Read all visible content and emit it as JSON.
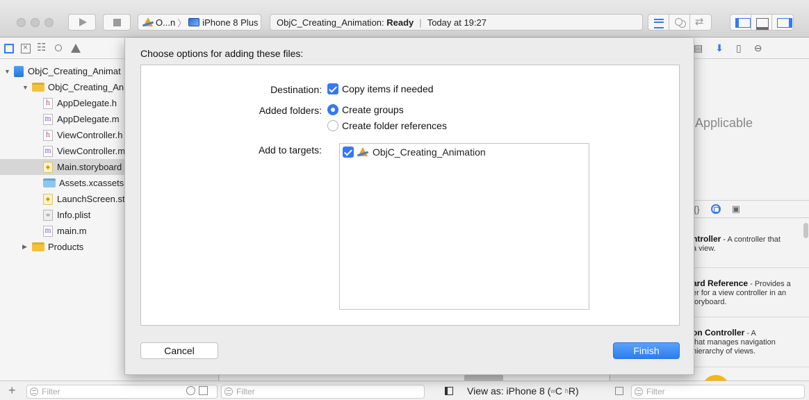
{
  "toolbar": {
    "scheme_name": "O...n",
    "device": "iPhone 8 Plus",
    "status_project": "ObjC_Creating_Animation:",
    "status_state": "Ready",
    "status_time": "Today at 19:27"
  },
  "navigator": {
    "items": [
      {
        "label": "ObjC_Creating_Animat",
        "kind": "project"
      },
      {
        "label": "ObjC_Creating_Anir",
        "kind": "folder"
      },
      {
        "label": "AppDelegate.h",
        "kind": "h"
      },
      {
        "label": "AppDelegate.m",
        "kind": "m"
      },
      {
        "label": "ViewController.h",
        "kind": "h"
      },
      {
        "label": "ViewController.m",
        "kind": "m"
      },
      {
        "label": "Main.storyboard",
        "kind": "storyboard"
      },
      {
        "label": "Assets.xcassets",
        "kind": "assets"
      },
      {
        "label": "LaunchScreen.st",
        "kind": "storyboard"
      },
      {
        "label": "Info.plist",
        "kind": "plist"
      },
      {
        "label": "main.m",
        "kind": "m"
      },
      {
        "label": "Products",
        "kind": "folder"
      }
    ],
    "file_letters": {
      "h": "h",
      "m": "m"
    },
    "filter_placeholder": "Filter"
  },
  "inspector": {
    "not_applicable": "Applicable",
    "library_items": [
      {
        "title": "ntroller",
        "desc_1": " - A controller that",
        "desc_2": "a view."
      },
      {
        "title": "ard Reference",
        "desc_1": " - Provides a",
        "desc_2": "er for a view controller in an",
        "desc_3": "toryboard."
      },
      {
        "title": "on Controller",
        "desc_1": " - A",
        "desc_2": "that manages navigation",
        "desc_3": "hierarchy of views."
      }
    ],
    "filter_placeholder": "Filter"
  },
  "editor": {
    "filter_placeholder": "Filter",
    "view_as_prefix": "View as: iPhone 8 (",
    "size_w": "w",
    "size_c": "C",
    "size_h": "h",
    "size_r": "R",
    "view_as_suffix": ")"
  },
  "dialog": {
    "title": "Choose options for adding these files:",
    "destination_label": "Destination:",
    "copy_items": "Copy items if needed",
    "added_folders_label": "Added folders:",
    "create_groups": "Create groups",
    "create_folder_refs": "Create folder references",
    "add_to_targets_label": "Add to targets:",
    "target_name": "ObjC_Creating_Animation",
    "cancel_label": "Cancel",
    "finish_label": "Finish"
  },
  "colors": {
    "accent": "#3478f6",
    "finish_button": "#2a7df3"
  }
}
